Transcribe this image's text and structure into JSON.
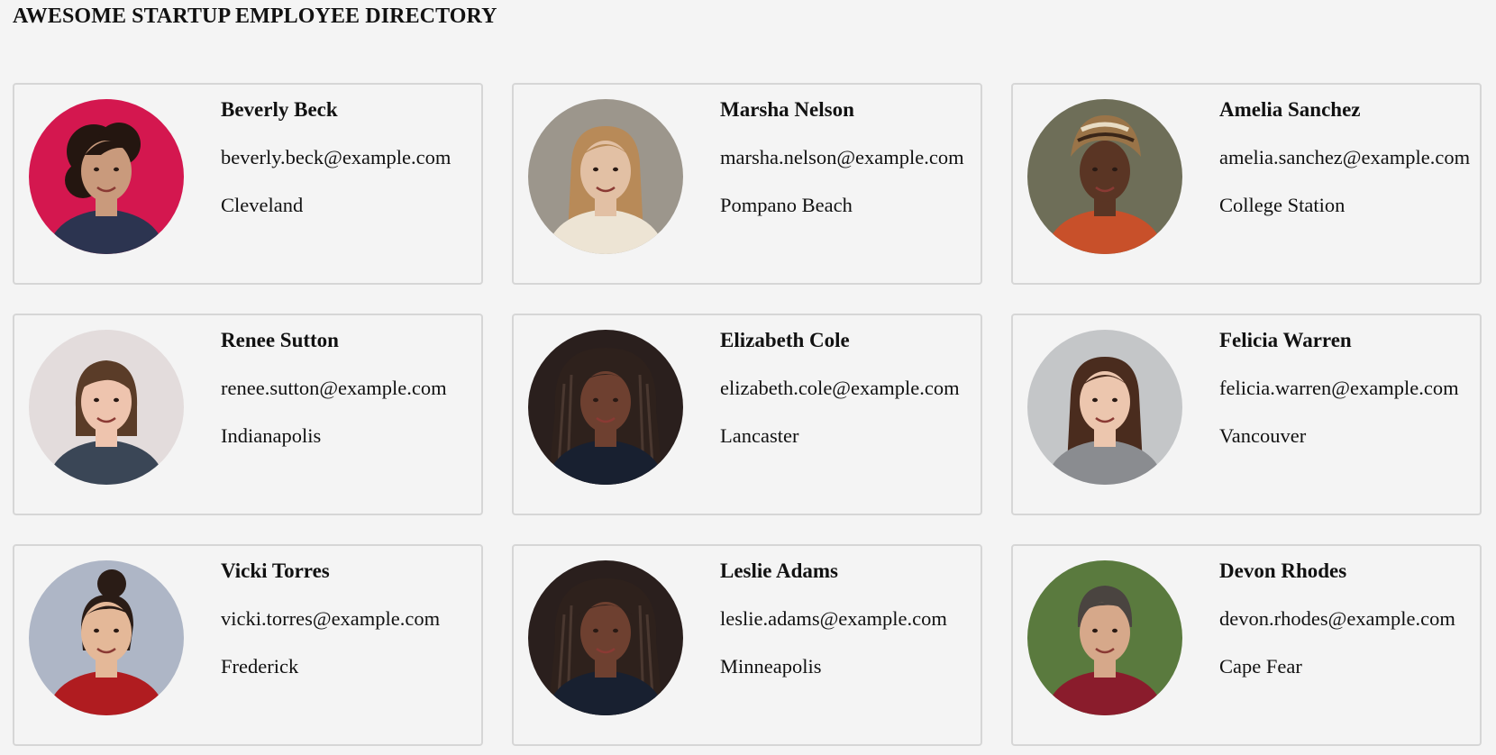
{
  "page": {
    "title": "AWESOME STARTUP EMPLOYEE DIRECTORY"
  },
  "employees": [
    {
      "name": "Beverly Beck",
      "email": "beverly.beck@example.com",
      "city": "Cleveland",
      "photo": {
        "bg": "#d4174f",
        "skin": "#c99a7c",
        "hair": "#241610",
        "shirt": "#2c3450",
        "style": "curly"
      }
    },
    {
      "name": "Marsha Nelson",
      "email": "marsha.nelson@example.com",
      "city": "Pompano Beach",
      "photo": {
        "bg": "#9c968c",
        "skin": "#e2c0a4",
        "hair": "#b88a58",
        "shirt": "#ede4d4",
        "style": "long"
      }
    },
    {
      "name": "Amelia Sanchez",
      "email": "amelia.sanchez@example.com",
      "city": "College Station",
      "photo": {
        "bg": "#6e6e58",
        "skin": "#5a3524",
        "hair": "#9a7448",
        "shirt": "#c8502a",
        "style": "wrap"
      }
    },
    {
      "name": "Renee Sutton",
      "email": "renee.sutton@example.com",
      "city": "Indianapolis",
      "photo": {
        "bg": "#e3dcdc",
        "skin": "#eec4ae",
        "hair": "#5a3c28",
        "shirt": "#3a4656",
        "style": "bob"
      }
    },
    {
      "name": "Elizabeth Cole",
      "email": "elizabeth.cole@example.com",
      "city": "Lancaster",
      "photo": {
        "bg": "#2a1f1d",
        "skin": "#6e4030",
        "hair": "#2e211c",
        "shirt": "#182030",
        "style": "braids"
      }
    },
    {
      "name": "Felicia Warren",
      "email": "felicia.warren@example.com",
      "city": "Vancouver",
      "photo": {
        "bg": "#c4c6c8",
        "skin": "#ecc6ae",
        "hair": "#4a2c1e",
        "shirt": "#8a8c90",
        "style": "long"
      }
    },
    {
      "name": "Vicki Torres",
      "email": "vicki.torres@example.com",
      "city": "Frederick",
      "photo": {
        "bg": "#aeb6c6",
        "skin": "#e4b898",
        "hair": "#2a1c16",
        "shirt": "#b01c20",
        "style": "bun"
      }
    },
    {
      "name": "Leslie Adams",
      "email": "leslie.adams@example.com",
      "city": "Minneapolis",
      "photo": {
        "bg": "#2a1f1d",
        "skin": "#6e4030",
        "hair": "#2e211c",
        "shirt": "#182030",
        "style": "braids"
      }
    },
    {
      "name": "Devon Rhodes",
      "email": "devon.rhodes@example.com",
      "city": "Cape Fear",
      "photo": {
        "bg": "#5a7a3e",
        "skin": "#d6a88a",
        "hair": "#4a4440",
        "shirt": "#8a1c2c",
        "style": "short"
      }
    }
  ]
}
